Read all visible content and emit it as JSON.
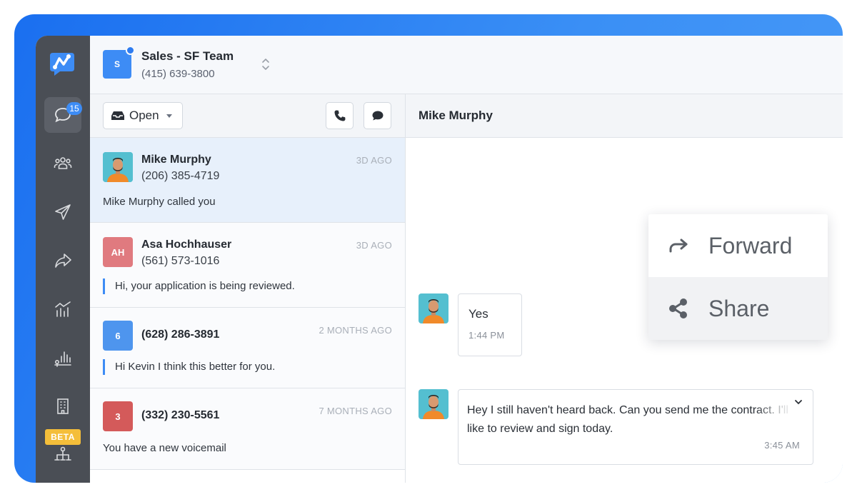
{
  "colors": {
    "accent": "#3d8cf5",
    "rail": "#4a4e55",
    "beta": "#f4be3a",
    "selected_row": "#e7f0fb"
  },
  "rail": {
    "unread_count": "15",
    "beta_label": "BETA",
    "icons": [
      "logo-icon",
      "messages-icon",
      "contacts-icon",
      "campaigns-icon",
      "forward-icon",
      "analytics-icon",
      "reports-icon",
      "building-icon",
      "workflow-icon"
    ]
  },
  "header": {
    "team_initial": "S",
    "team_name": "Sales - SF Team",
    "team_phone": "(415) 639-3800"
  },
  "list": {
    "filter_label": "Open",
    "conversations": [
      {
        "name": "Mike Murphy",
        "phone": "(206) 385-4719",
        "time": "3D AGO",
        "preview": "Mike Murphy called you",
        "avatar": "photo"
      },
      {
        "name": "Asa Hochhauser",
        "initials": "AH",
        "phone": "(561) 573-1016",
        "time": "3D AGO",
        "preview": "Hi, your application is being reviewed.",
        "avatar_color": "#e07a7f"
      },
      {
        "initials": "6",
        "phone": "(628) 286-3891",
        "time": "2 MONTHS AGO",
        "preview": "Hi Kevin I think this better for you.",
        "avatar_color": "#4e95ee"
      },
      {
        "initials": "3",
        "phone": "(332) 230-5561",
        "time": "7 MONTHS AGO",
        "preview": "You have a new voicemail",
        "avatar_color": "#d45a5a"
      }
    ]
  },
  "chat": {
    "title": "Mike Murphy",
    "messages": [
      {
        "text": "Yes",
        "time": "1:44 PM"
      },
      {
        "text": "Hey I still haven't heard back. Can you send me the contract. I'll like to review and sign today.",
        "time": "3:45 AM"
      }
    ]
  },
  "menu": {
    "items": [
      {
        "label": "Forward",
        "icon": "forward-arrow-icon"
      },
      {
        "label": "Share",
        "icon": "share-icon"
      }
    ]
  }
}
